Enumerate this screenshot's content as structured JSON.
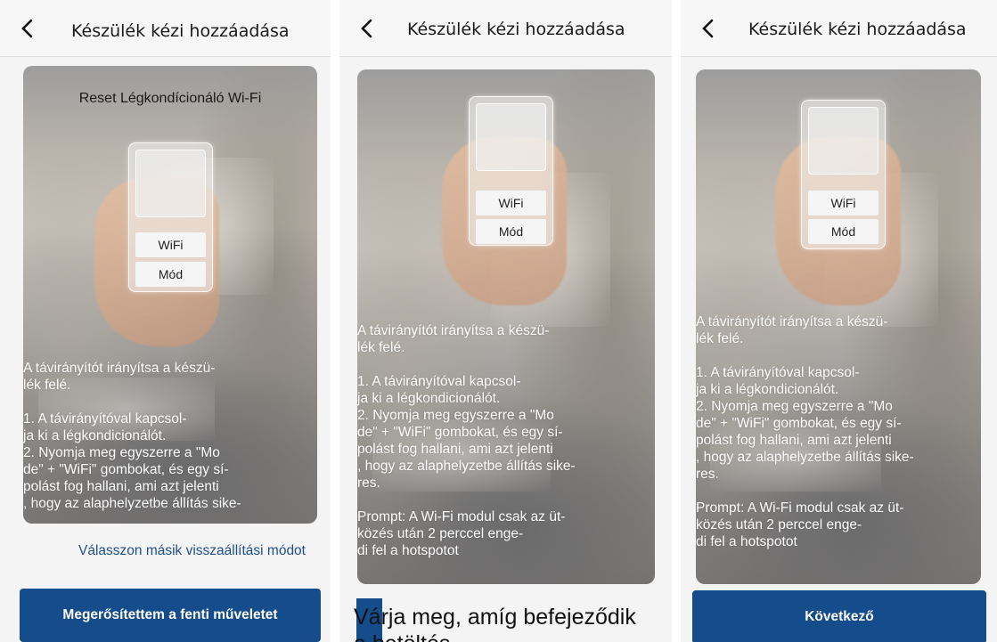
{
  "colors": {
    "accent": "#154c8b",
    "link": "#1f4e8c",
    "background": "#f4f4f4"
  },
  "panels": [
    {
      "header": {
        "back_icon": "chevron-left-icon",
        "title": "Készülék kézi hozzáadása"
      },
      "card_title": "Reset Légkondícionáló Wi-Fi",
      "remote": {
        "wifi_label": "WiFi",
        "mode_label": "Mód"
      },
      "instructions": "A távirányítót irányítsa a készü-\nlék felé.\n\n1. A távirányítóval kapcsol-\nja ki a légkondicionálót.\n 2. Nyomja meg egyszerre a \"Mo\nde\" + \"WiFi\" gombokat, és egy sí-\npolást fog hallani, ami azt jelenti\n, hogy az alaphelyzetbe állítás sike-",
      "link": "Válasszon másik visszaállítási módot",
      "button": "Megerősítettem a fenti műveletet"
    },
    {
      "header": {
        "back_icon": "chevron-left-icon",
        "title": "Készülék kézi hozzáadása"
      },
      "remote": {
        "wifi_label": "WiFi",
        "mode_label": "Mód"
      },
      "instructions": "A távirányítót irányítsa a készü-\nlék felé.\n\n1. A távirányítóval kapcsol-\nja ki a légkondicionálót.\n 2. Nyomja meg egyszerre a \"Mo\nde\" + \"WiFi\" gombokat, és egy sí-\npolást fog hallani, ami azt jelenti\n, hogy az alaphelyzetbe állítás sike-\nres.\n\nPrompt: A Wi-Fi modul csak az üt-\nközés után 2 perccel enge-\ndi fel a hotspotot",
      "loading_text": "Várja meg, amíg befejeződik\na betöltés"
    },
    {
      "header": {
        "back_icon": "chevron-left-icon",
        "title": "Készülék kézi hozzáadása"
      },
      "remote": {
        "wifi_label": "WiFi",
        "mode_label": "Mód"
      },
      "instructions": "A távirányítót irányítsa a készü-\nlék felé.\n\n1. A távirányítóval kapcsol-\nja ki a légkondicionálót.\n 2. Nyomja meg egyszerre a \"Mo\nde\" + \"WiFi\" gombokat, és egy sí-\npolást fog hallani, ami azt jelenti\n, hogy az alaphelyzetbe állítás sike-\nres.\n\nPrompt: A Wi-Fi modul csak az üt-\nközés után 2 perccel enge-\ndi fel a hotspotot",
      "button": "Következő"
    }
  ]
}
